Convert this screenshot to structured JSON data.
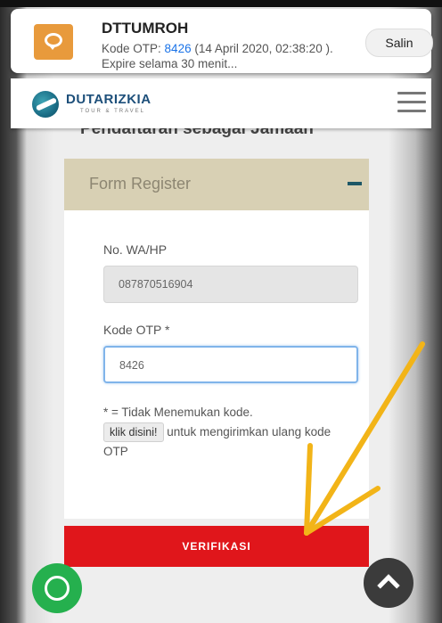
{
  "notification": {
    "app_name": "DTTUMROH",
    "body_prefix": "Kode OTP: ",
    "otp_code": "8426",
    "body_suffix": " (14 April 2020, 02:38:20 ). Expire selama 30 menit...",
    "copy_button": "Salin",
    "icon": "chat-bubble-icon"
  },
  "header": {
    "logo_name": "DUTARIZKIA",
    "logo_tagline": "TOUR & TRAVEL",
    "menu_icon": "hamburger-menu-icon"
  },
  "page": {
    "title": "Pendaftaran sebagai Jamaah"
  },
  "form": {
    "section_title": "Form Register",
    "collapse_icon": "minus-icon",
    "phone_label": "No. WA/HP",
    "phone_value": "087870516904",
    "otp_label": "Kode OTP *",
    "otp_value": "8426",
    "note_line": "* = Tidak Menemukan kode.",
    "resend_link": "klik disini!",
    "resend_text": " untuk mengirimkan ulang kode OTP",
    "submit_label": "VERIFIKASI"
  },
  "floating": {
    "whatsapp_icon": "whatsapp-icon",
    "scroll_top_icon": "chevron-up-icon"
  },
  "colors": {
    "accent_red": "#e0161b",
    "card_header": "#d8d0b4",
    "whatsapp_green": "#25b04e",
    "annotation_arrow": "#f2b418"
  }
}
